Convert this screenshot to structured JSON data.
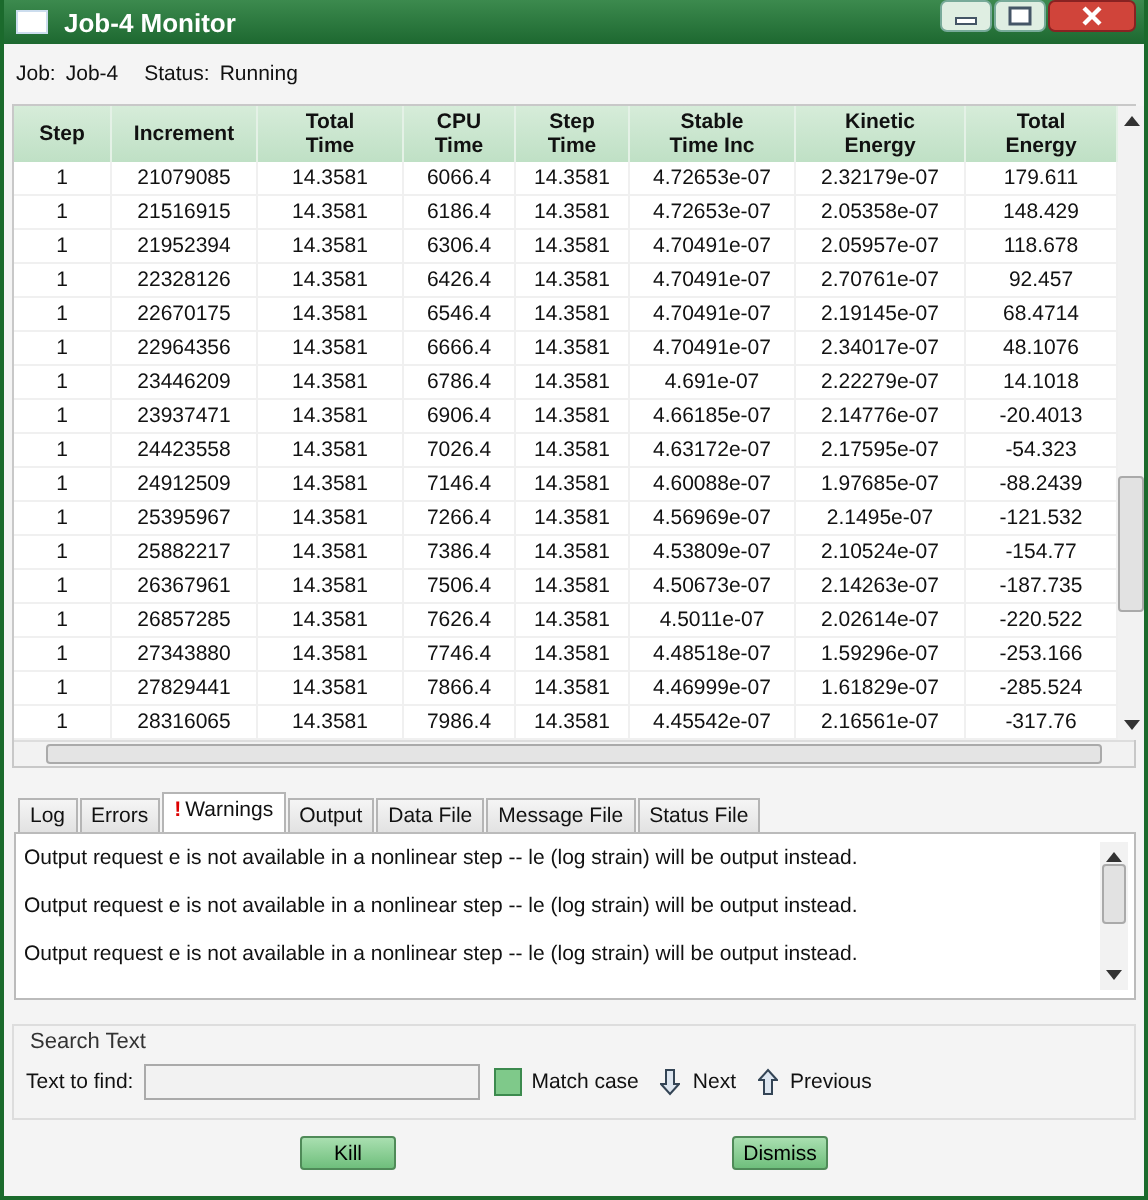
{
  "window": {
    "title": "Job-4 Monitor"
  },
  "job": {
    "job_label": "Job:",
    "job_value": "Job-4",
    "status_label": "Status:",
    "status_value": "Running"
  },
  "table": {
    "columns": [
      "Step",
      "Increment",
      "Total\nTime",
      "CPU\nTime",
      "Step\nTime",
      "Stable\nTime Inc",
      "Kinetic\nEnergy",
      "Total\nEnergy"
    ],
    "rows": [
      [
        "1",
        "21079085",
        "14.3581",
        "6066.4",
        "14.3581",
        "4.72653e-07",
        "2.32179e-07",
        "179.611"
      ],
      [
        "1",
        "21516915",
        "14.3581",
        "6186.4",
        "14.3581",
        "4.72653e-07",
        "2.05358e-07",
        "148.429"
      ],
      [
        "1",
        "21952394",
        "14.3581",
        "6306.4",
        "14.3581",
        "4.70491e-07",
        "2.05957e-07",
        "118.678"
      ],
      [
        "1",
        "22328126",
        "14.3581",
        "6426.4",
        "14.3581",
        "4.70491e-07",
        "2.70761e-07",
        "92.457"
      ],
      [
        "1",
        "22670175",
        "14.3581",
        "6546.4",
        "14.3581",
        "4.70491e-07",
        "2.19145e-07",
        "68.4714"
      ],
      [
        "1",
        "22964356",
        "14.3581",
        "6666.4",
        "14.3581",
        "4.70491e-07",
        "2.34017e-07",
        "48.1076"
      ],
      [
        "1",
        "23446209",
        "14.3581",
        "6786.4",
        "14.3581",
        "4.691e-07",
        "2.22279e-07",
        "14.1018"
      ],
      [
        "1",
        "23937471",
        "14.3581",
        "6906.4",
        "14.3581",
        "4.66185e-07",
        "2.14776e-07",
        "-20.4013"
      ],
      [
        "1",
        "24423558",
        "14.3581",
        "7026.4",
        "14.3581",
        "4.63172e-07",
        "2.17595e-07",
        "-54.323"
      ],
      [
        "1",
        "24912509",
        "14.3581",
        "7146.4",
        "14.3581",
        "4.60088e-07",
        "1.97685e-07",
        "-88.2439"
      ],
      [
        "1",
        "25395967",
        "14.3581",
        "7266.4",
        "14.3581",
        "4.56969e-07",
        "2.1495e-07",
        "-121.532"
      ],
      [
        "1",
        "25882217",
        "14.3581",
        "7386.4",
        "14.3581",
        "4.53809e-07",
        "2.10524e-07",
        "-154.77"
      ],
      [
        "1",
        "26367961",
        "14.3581",
        "7506.4",
        "14.3581",
        "4.50673e-07",
        "2.14263e-07",
        "-187.735"
      ],
      [
        "1",
        "26857285",
        "14.3581",
        "7626.4",
        "14.3581",
        "4.5011e-07",
        "2.02614e-07",
        "-220.522"
      ],
      [
        "1",
        "27343880",
        "14.3581",
        "7746.4",
        "14.3581",
        "4.48518e-07",
        "1.59296e-07",
        "-253.166"
      ],
      [
        "1",
        "27829441",
        "14.3581",
        "7866.4",
        "14.3581",
        "4.46999e-07",
        "1.61829e-07",
        "-285.524"
      ],
      [
        "1",
        "28316065",
        "14.3581",
        "7986.4",
        "14.3581",
        "4.45542e-07",
        "2.16561e-07",
        "-317.76"
      ]
    ]
  },
  "tabs": [
    {
      "label": "Log",
      "selected": false,
      "warning": false
    },
    {
      "label": "Errors",
      "selected": false,
      "warning": false
    },
    {
      "label": "Warnings",
      "selected": true,
      "warning": true
    },
    {
      "label": "Output",
      "selected": false,
      "warning": false
    },
    {
      "label": "Data File",
      "selected": false,
      "warning": false
    },
    {
      "label": "Message File",
      "selected": false,
      "warning": false
    },
    {
      "label": "Status File",
      "selected": false,
      "warning": false
    }
  ],
  "warning_mark": "!",
  "messages": [
    "Output request e is not available in a nonlinear step -- le (log strain) will be output instead.",
    "Output request e is not available in a nonlinear step -- le (log strain) will be output instead.",
    "Output request e is not available in a nonlinear step -- le (log strain) will be output instead."
  ],
  "search": {
    "title": "Search Text",
    "label": "Text to find:",
    "match_case": {
      "label": "Match case",
      "checked": false
    },
    "next": "Next",
    "previous": "Previous"
  },
  "buttons": [
    "Kill",
    "Dismiss"
  ]
}
